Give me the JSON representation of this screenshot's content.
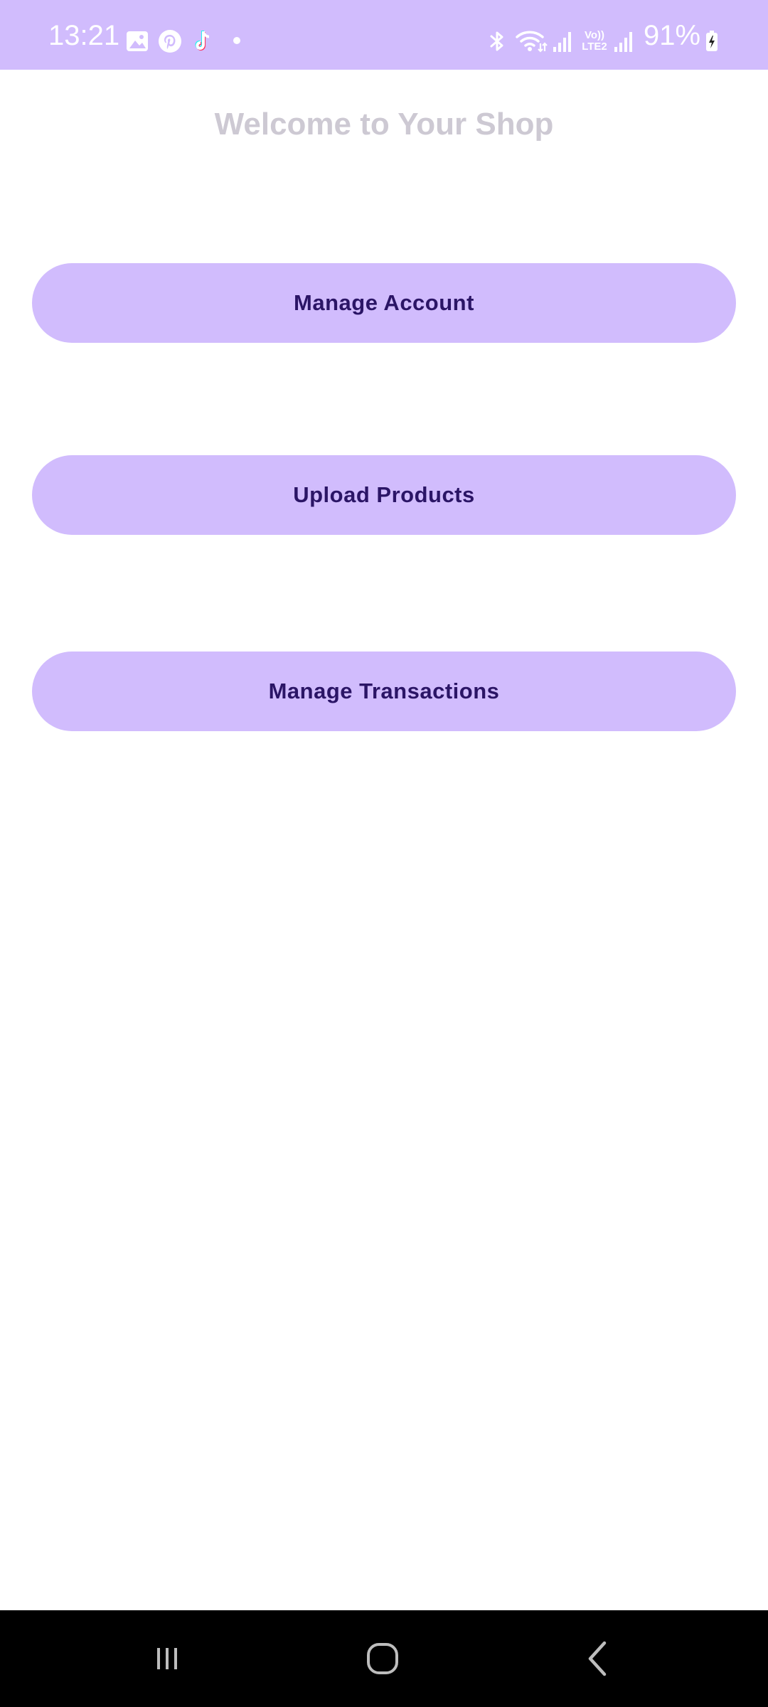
{
  "status_bar": {
    "time": "13:21",
    "battery_percent": "91%",
    "network_label": "Vo)) LTE2",
    "notification_icons": [
      "gallery-icon",
      "pinterest-icon",
      "tiktok-icon",
      "dot-icon"
    ],
    "system_icons": [
      "bluetooth-icon",
      "wifi-icon",
      "signal-icon",
      "signal-icon",
      "battery-charging-icon"
    ]
  },
  "main": {
    "title": "Welcome to Your Shop",
    "buttons": [
      {
        "label": "Manage Account"
      },
      {
        "label": "Upload Products"
      },
      {
        "label": "Manage Transactions"
      }
    ]
  },
  "nav_bar": {
    "icons": [
      "recent-apps-icon",
      "home-icon",
      "back-icon"
    ]
  },
  "colors": {
    "accent": "#d1bcfd",
    "button_text": "#2b1566",
    "title_text": "#cdc9d3",
    "nav_background": "#000000"
  }
}
